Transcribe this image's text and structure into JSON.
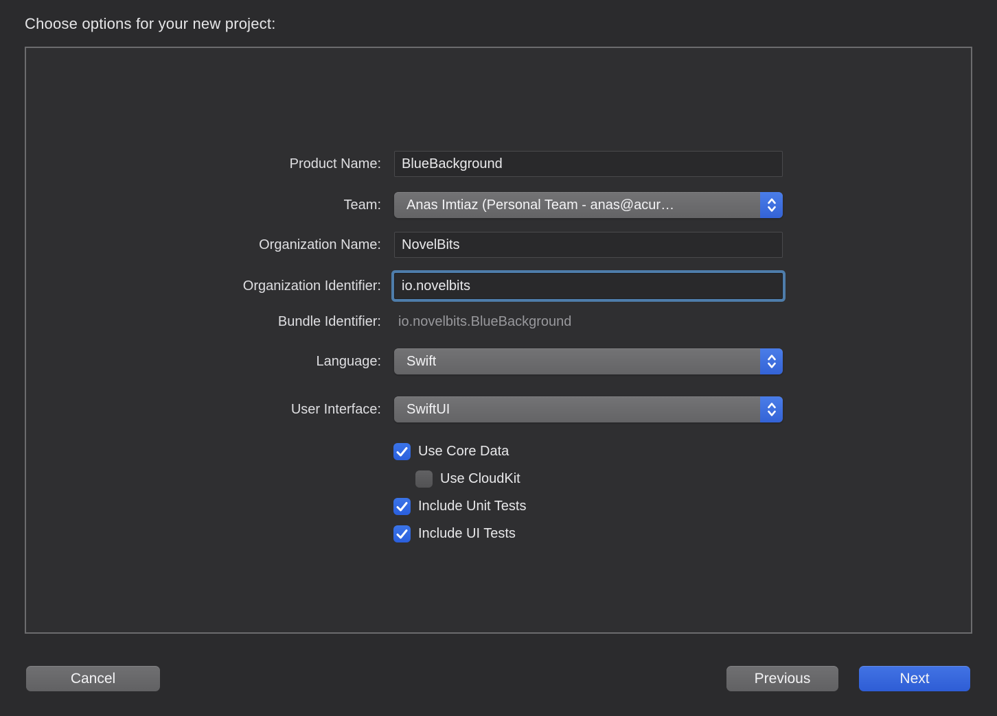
{
  "title": "Choose options for your new project:",
  "form": {
    "product_name": {
      "label": "Product Name:",
      "value": "BlueBackground"
    },
    "team": {
      "label": "Team:",
      "value": "Anas Imtiaz (Personal Team - anas@acur…"
    },
    "organization_name": {
      "label": "Organization Name:",
      "value": "NovelBits"
    },
    "organization_identifier": {
      "label": "Organization Identifier:",
      "value": "io.novelbits"
    },
    "bundle_identifier": {
      "label": "Bundle Identifier:",
      "value": "io.novelbits.BlueBackground"
    },
    "language": {
      "label": "Language:",
      "value": "Swift"
    },
    "user_interface": {
      "label": "User Interface:",
      "value": "SwiftUI"
    }
  },
  "checkboxes": {
    "use_core_data": {
      "label": "Use Core Data",
      "checked": true
    },
    "use_cloudkit": {
      "label": "Use CloudKit",
      "checked": false
    },
    "include_unit_tests": {
      "label": "Include Unit Tests",
      "checked": true
    },
    "include_ui_tests": {
      "label": "Include UI Tests",
      "checked": true
    }
  },
  "buttons": {
    "cancel": "Cancel",
    "previous": "Previous",
    "next": "Next"
  },
  "colors": {
    "background": "#2b2b2d",
    "panel": "#2f2f31",
    "panel_border": "#6c6c6e",
    "accent_blue": "#3a6ce0",
    "focus_ring": "#4e7dab",
    "checkbox_blue": "#2f6be4",
    "button_gray": "#696969",
    "muted_text": "#98989c"
  }
}
